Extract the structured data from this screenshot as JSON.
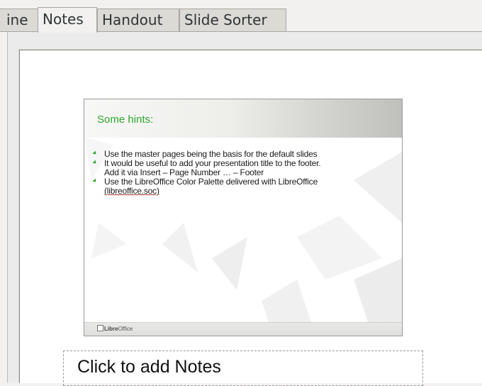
{
  "tabs": [
    {
      "label": "ine",
      "active": false
    },
    {
      "label": "Notes",
      "active": true
    },
    {
      "label": "Handout",
      "active": false
    },
    {
      "label": "Slide Sorter",
      "active": false
    }
  ],
  "slide": {
    "title": "Some hints:",
    "bullets": [
      {
        "lines": [
          "Use the master pages being the basis for the default slides"
        ]
      },
      {
        "lines": [
          "It would be useful to add your presentation title to the footer.",
          "Add it via Insert – Page Number … – Footer"
        ]
      },
      {
        "lines": [
          "Use the LibreOffice Color Palette delivered with LibreOffice"
        ],
        "link": "(libreoffice.soc)"
      }
    ],
    "footer_logo": {
      "bold": "Libre",
      "rest": "Office"
    }
  },
  "notes": {
    "placeholder": "Click to add Notes"
  },
  "colors": {
    "accent_green": "#2ea72e",
    "window_bg": "#f2f1f0"
  }
}
